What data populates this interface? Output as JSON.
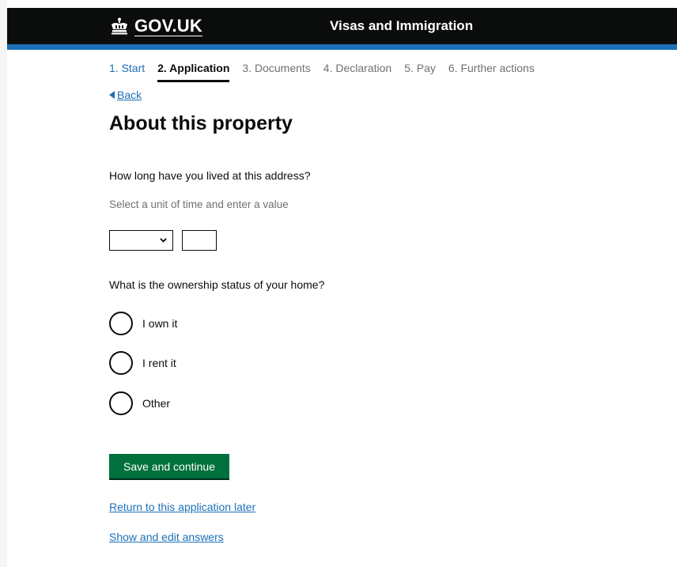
{
  "header": {
    "brand": "GOV.UK",
    "service_name": "Visas and Immigration"
  },
  "steps": [
    "1. Start",
    "2. Application",
    "3. Documents",
    "4. Declaration",
    "5. Pay",
    "6. Further actions"
  ],
  "back_label": "Back",
  "page_title": "About this property",
  "question_duration": {
    "label": "How long have you lived at this address?",
    "hint": "Select a unit of time and enter a value",
    "unit_selected": "",
    "value": ""
  },
  "question_ownership": {
    "label": "What is the ownership status of your home?",
    "options": [
      "I own it",
      "I rent it",
      "Other"
    ]
  },
  "save_button": "Save and continue",
  "links": {
    "return_later": "Return to this application later",
    "show_edit": "Show and edit answers"
  },
  "colors": {
    "header_bg": "#0b0c0c",
    "accent_blue": "#1d70b8",
    "button_green": "#00703c",
    "hint_grey": "#6f7173"
  }
}
